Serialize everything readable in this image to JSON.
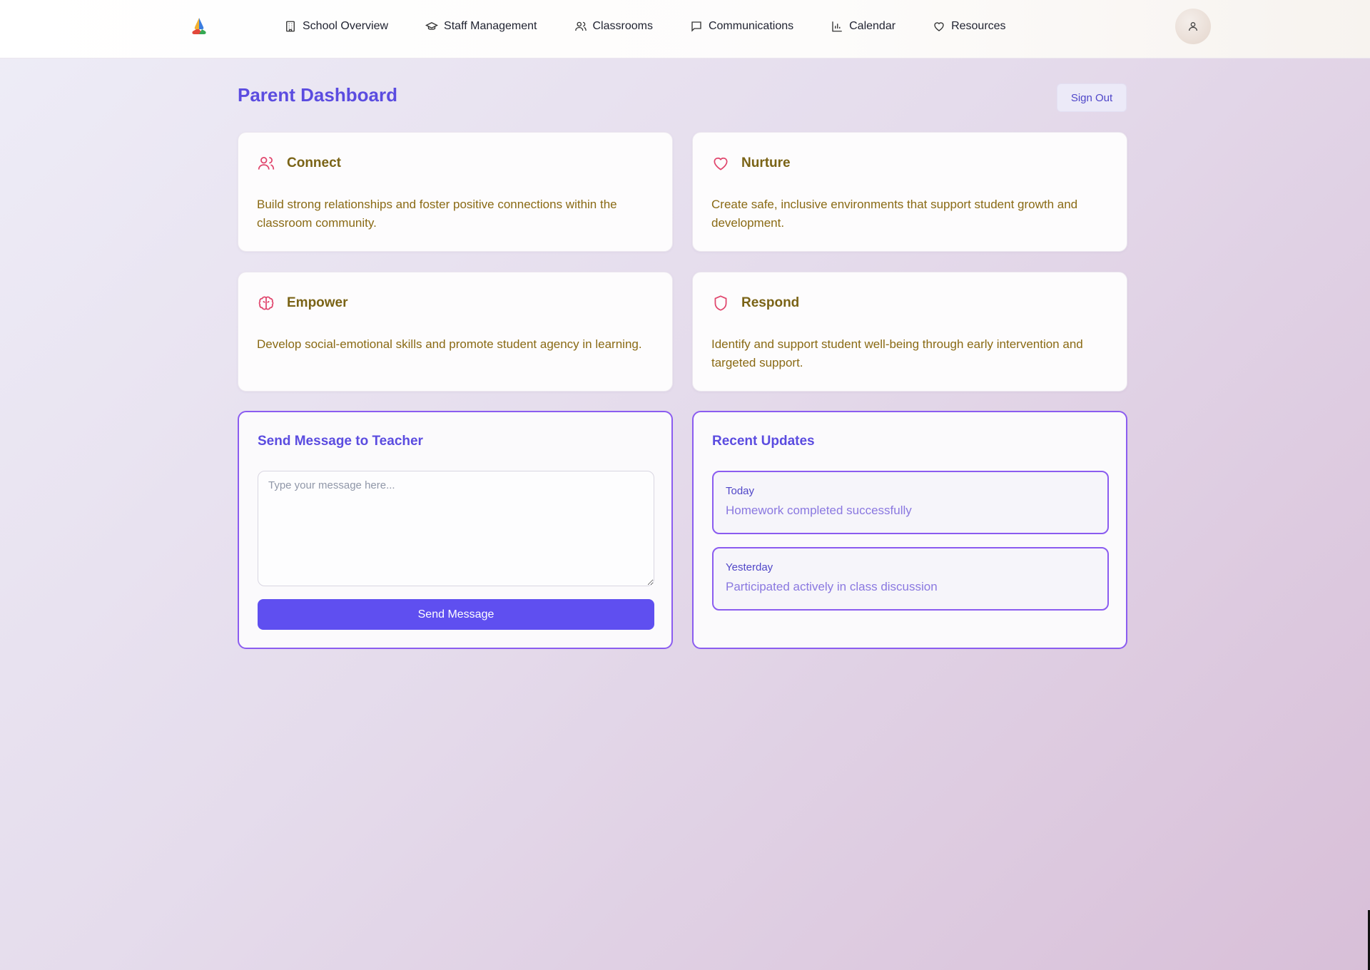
{
  "nav": {
    "logo": "tri-color-logo",
    "items": [
      {
        "label": "School Overview",
        "icon": "building-icon"
      },
      {
        "label": "Staff Management",
        "icon": "graduation-cap-icon"
      },
      {
        "label": "Classrooms",
        "icon": "users-icon"
      },
      {
        "label": "Communications",
        "icon": "message-square-icon"
      },
      {
        "label": "Calendar",
        "icon": "bar-chart-icon"
      },
      {
        "label": "Resources",
        "icon": "heart-icon"
      }
    ],
    "avatar_icon": "user-icon"
  },
  "header": {
    "title": "Parent Dashboard",
    "sign_out": "Sign Out"
  },
  "cards": [
    {
      "title": "Connect",
      "icon": "users-icon",
      "body": "Build strong relationships and foster positive connections within the classroom community."
    },
    {
      "title": "Nurture",
      "icon": "heart-icon",
      "body": "Create safe, inclusive environments that support student growth and development."
    },
    {
      "title": "Empower",
      "icon": "brain-icon",
      "body": "Develop social-emotional skills and promote student agency in learning."
    },
    {
      "title": "Respond",
      "icon": "shield-icon",
      "body": "Identify and support student well-being through early intervention and targeted support."
    }
  ],
  "message_panel": {
    "title": "Send Message to Teacher",
    "placeholder": "Type your message here...",
    "value": "",
    "send_label": "Send Message"
  },
  "updates_panel": {
    "title": "Recent Updates",
    "items": [
      {
        "when": "Today",
        "text": "Homework completed successfully"
      },
      {
        "when": "Yesterday",
        "text": "Participated actively in class discussion"
      }
    ]
  },
  "colors": {
    "accent": "#5f4ff0",
    "title": "#5b4ce0",
    "card_title": "#7a6316",
    "card_icon": "#e0456c",
    "panel_border": "#8b5cf0"
  }
}
